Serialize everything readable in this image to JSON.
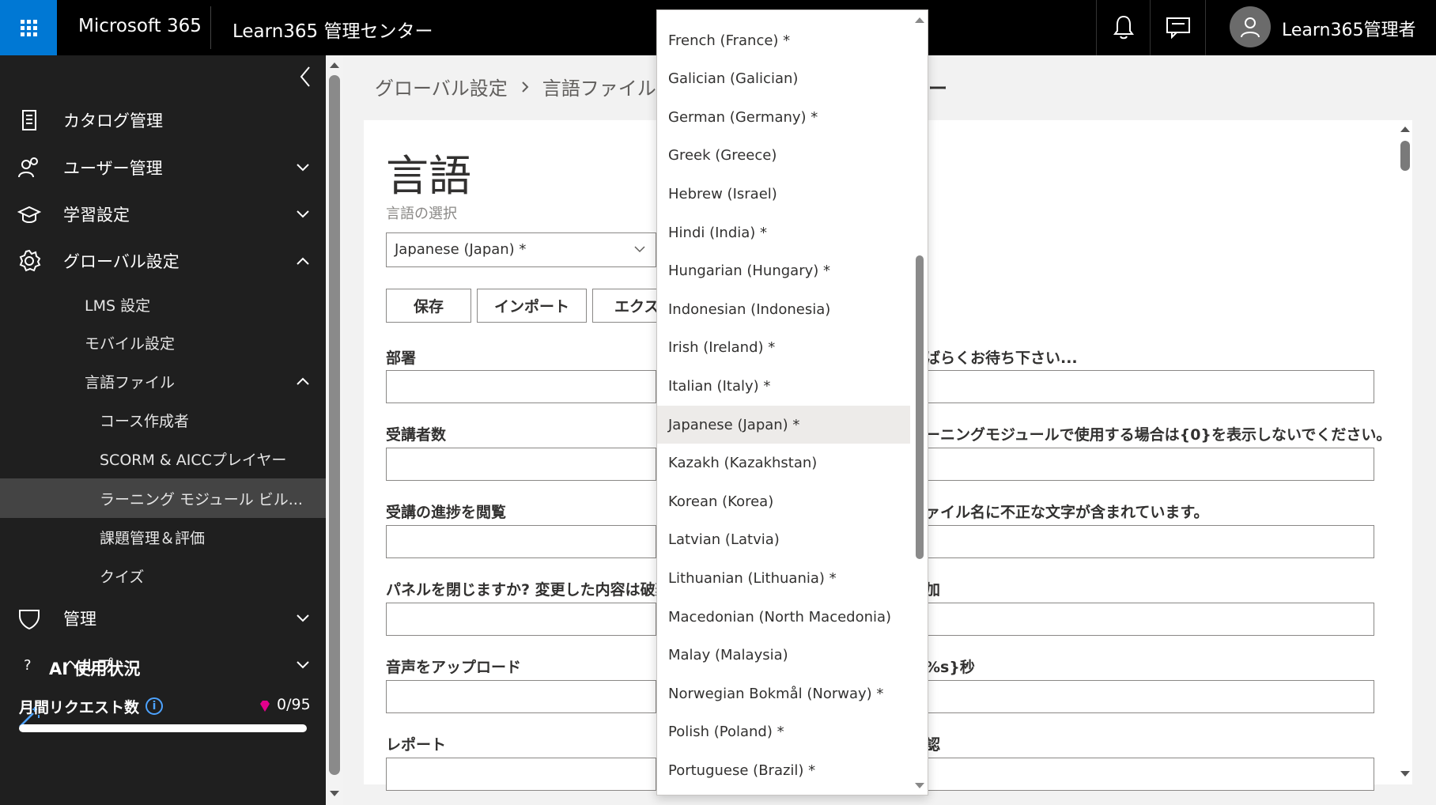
{
  "topbar": {
    "brand": "Microsoft 365",
    "app_title": "Learn365 管理センター",
    "user_name": "Learn365管理者"
  },
  "sidebar": {
    "nav": [
      {
        "label": "カタログ管理",
        "icon": "catalog-icon",
        "chevron": "none"
      },
      {
        "label": "ユーザー管理",
        "icon": "users-icon",
        "chevron": "down"
      },
      {
        "label": "学習設定",
        "icon": "graduation-cap-icon",
        "chevron": "down"
      },
      {
        "label": "グローバル設定",
        "icon": "gear-icon",
        "chevron": "up"
      }
    ],
    "global_sub": [
      {
        "label": "LMS 設定"
      },
      {
        "label": "モバイル設定"
      },
      {
        "label": "言語ファイル"
      }
    ],
    "language_sub": [
      {
        "label": "コース作成者"
      },
      {
        "label": "SCORM & AICCプレイヤー"
      },
      {
        "label": "ラーニング モジュール ビル..."
      },
      {
        "label": "課題管理＆評価"
      },
      {
        "label": "クイズ"
      }
    ],
    "bottom_nav": [
      {
        "label": "管理",
        "icon": "shield-icon"
      },
      {
        "label": "ヘルプ",
        "icon": "help-icon",
        "glyph": "?"
      }
    ],
    "ai": {
      "label": "AI 使用状況",
      "monthly_label": "月間リクエスト数",
      "quota": "0/95",
      "used": 0,
      "limit": 95
    }
  },
  "breadcrumb": {
    "items": [
      "グローバル設定",
      "言語ファイル"
    ],
    "suffix": "ダー"
  },
  "page": {
    "title": "言語",
    "lang_label": "言語の選択",
    "selected_language": "Japanese (Japan) *",
    "buttons": [
      "保存",
      "インポート",
      "エクス"
    ]
  },
  "fields_left": [
    "部署",
    "受講者数",
    "受講の進捗を閲覧",
    "パネルを閉じますか? 変更した内容は破棄",
    "音声をアップロード",
    "レポート"
  ],
  "fields_right": [
    "ばらくお待ち下さい...",
    "ーニングモジュールで使用する場合は{0}を表示しないでください。",
    "ァイル名に不正な文字が含まれています。",
    "加",
    "%s}秒",
    "認"
  ],
  "dropdown": {
    "items": [
      "French (France) *",
      "Galician (Galician)",
      "German (Germany) *",
      "Greek (Greece)",
      "Hebrew (Israel)",
      "Hindi (India) *",
      "Hungarian (Hungary) *",
      "Indonesian (Indonesia)",
      "Irish (Ireland) *",
      "Italian (Italy) *",
      "Japanese (Japan) *",
      "Kazakh (Kazakhstan)",
      "Korean (Korea)",
      "Latvian (Latvia)",
      "Lithuanian (Lithuania) *",
      "Macedonian (North Macedonia)",
      "Malay (Malaysia)",
      "Norwegian Bokmål (Norway) *",
      "Polish (Poland) *",
      "Portuguese (Brazil) *"
    ],
    "selected_index": 10
  },
  "colors": {
    "accent": "#0078d4",
    "sidebar_bg": "#1f1f1f",
    "active_item": "#444444",
    "gem": "#e3008c"
  }
}
